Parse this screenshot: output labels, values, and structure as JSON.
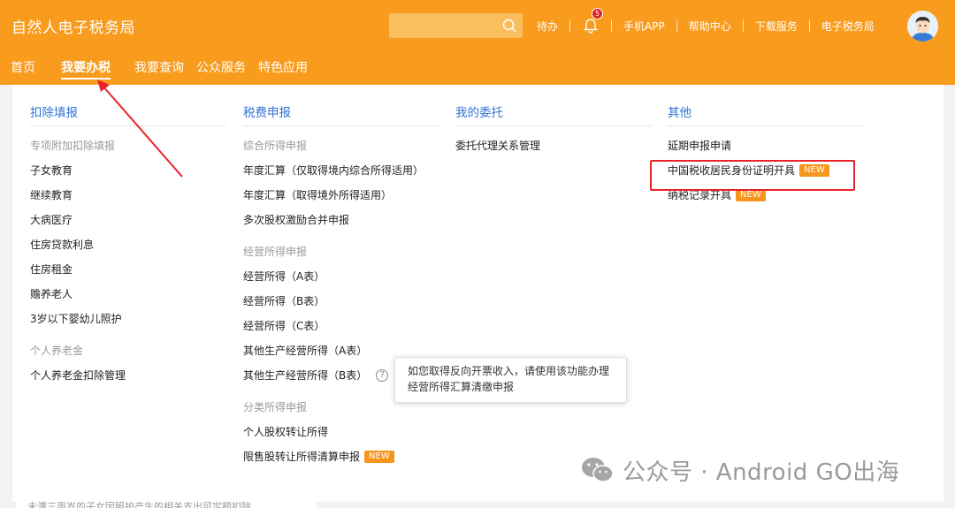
{
  "header": {
    "site_title": "自然人电子税务局",
    "search_placeholder": "",
    "top_links": [
      "待办",
      "手机APP",
      "帮助中心",
      "下载服务",
      "电子税务局"
    ],
    "notification_count": "5"
  },
  "nav": {
    "items": [
      "首页",
      "我要办税",
      "我要查询",
      "公众服务",
      "特色应用"
    ],
    "active": "我要办税"
  },
  "columns": [
    {
      "title": "扣除填报",
      "sections": [
        {
          "group": "专项附加扣除填报",
          "items": [
            "子女教育",
            "继续教育",
            "大病医疗",
            "住房贷款利息",
            "住房租金",
            "赡养老人",
            "3岁以下婴幼儿照护"
          ]
        },
        {
          "group": "个人养老金",
          "items": [
            "个人养老金扣除管理"
          ]
        }
      ]
    },
    {
      "title": "税费申报",
      "sections": [
        {
          "group": "综合所得申报",
          "items": [
            "年度汇算（仅取得境内综合所得适用）",
            "年度汇算（取得境外所得适用）",
            "多次股权激励合并申报"
          ]
        },
        {
          "group": "经营所得申报",
          "items": [
            "经营所得（A表）",
            "经营所得（B表）",
            "经营所得（C表）",
            "其他生产经营所得（A表）",
            "其他生产经营所得（B表）"
          ]
        },
        {
          "group": "分类所得申报",
          "items": [
            "个人股权转让所得",
            "限售股转让所得清算申报"
          ]
        }
      ]
    },
    {
      "title": "我的委托",
      "items": [
        "委托代理关系管理"
      ]
    },
    {
      "title": "其他",
      "items": [
        "延期申报申请",
        "中国税收居民身份证明开具",
        "纳税记录开具"
      ]
    }
  ],
  "badge_new": "NEW",
  "help_mark": "?",
  "tooltip": {
    "line1": "如您取得反向开票收入，请使用该功能办理",
    "line2": "经营所得汇算清缴申报"
  },
  "bottom_hint": "未满三周岁的子女因照护产生的相关支出可定额扣除",
  "watermark": "公众号 · Android GO出海",
  "colors": {
    "header": "#f99b1c",
    "link_blue": "#2e73d4",
    "badge": "#f7961e",
    "highlight": "#e8232a"
  }
}
